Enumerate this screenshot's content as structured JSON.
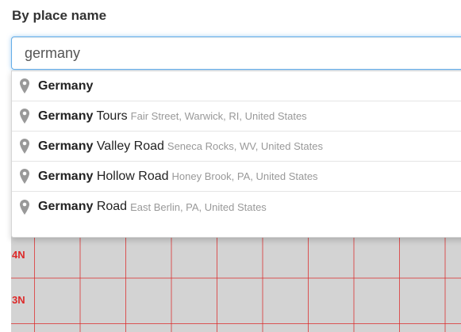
{
  "section": {
    "label": "By place name"
  },
  "search": {
    "value": "germany"
  },
  "suggestions": [
    {
      "match": "Germany",
      "rest": "",
      "detail": ""
    },
    {
      "match": "Germany",
      "rest": " Tours",
      "detail": "Fair Street, Warwick, RI, United States"
    },
    {
      "match": "Germany",
      "rest": " Valley Road",
      "detail": "Seneca Rocks, WV, United States"
    },
    {
      "match": "Germany",
      "rest": " Hollow Road",
      "detail": "Honey Brook, PA, United States"
    },
    {
      "match": "Germany",
      "rest": " Road",
      "detail": "East Berlin, PA, United States"
    }
  ],
  "map": {
    "grid_labels": [
      "4N",
      "3N"
    ]
  },
  "colors": {
    "input_focus": "#66afe9",
    "grid_line": "#dd2a2a",
    "map_bg": "#d3d3d3",
    "pin": "#999999"
  },
  "icons": {
    "suggestion": "map-pin-icon"
  }
}
